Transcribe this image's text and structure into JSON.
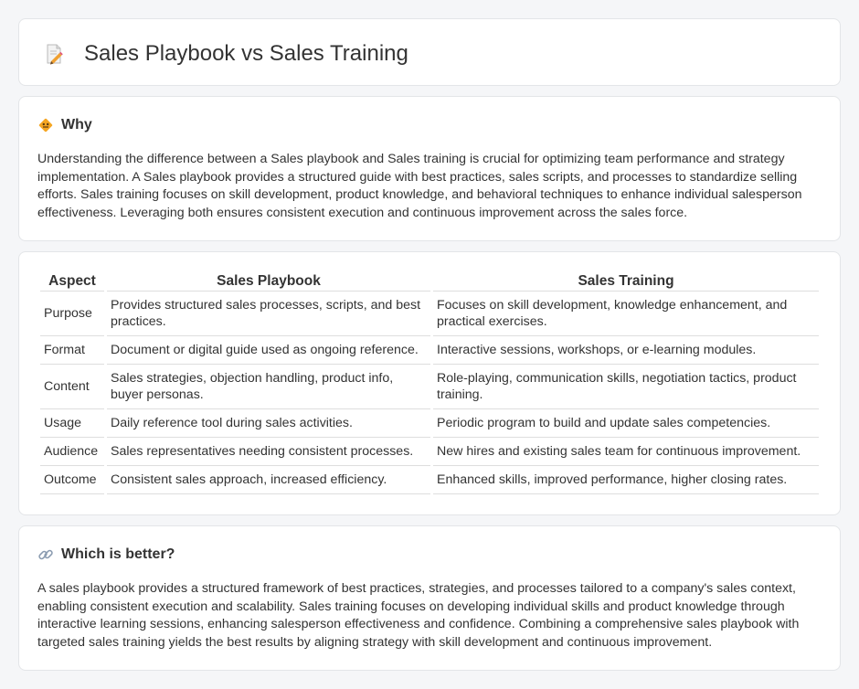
{
  "header": {
    "title": "Sales Playbook vs Sales Training",
    "icon": "document-pencil-icon"
  },
  "why": {
    "icon": "diamond-sign-icon",
    "title": "Why",
    "text": "Understanding the difference between a Sales playbook and Sales training is crucial for optimizing team performance and strategy implementation. A Sales playbook provides a structured guide with best practices, sales scripts, and processes to standardize selling efforts. Sales training focuses on skill development, product knowledge, and behavioral techniques to enhance individual salesperson effectiveness. Leveraging both ensures consistent execution and continuous improvement across the sales force."
  },
  "table": {
    "headers": [
      "Aspect",
      "Sales Playbook",
      "Sales Training"
    ],
    "rows": [
      [
        "Purpose",
        "Provides structured sales processes, scripts, and best practices.",
        "Focuses on skill development, knowledge enhancement, and practical exercises."
      ],
      [
        "Format",
        "Document or digital guide used as ongoing reference.",
        "Interactive sessions, workshops, or e-learning modules."
      ],
      [
        "Content",
        "Sales strategies, objection handling, product info, buyer personas.",
        "Role-playing, communication skills, negotiation tactics, product training."
      ],
      [
        "Usage",
        "Daily reference tool during sales activities.",
        "Periodic program to build and update sales competencies."
      ],
      [
        "Audience",
        "Sales representatives needing consistent processes.",
        "New hires and existing sales team for continuous improvement."
      ],
      [
        "Outcome",
        "Consistent sales approach, increased efficiency.",
        "Enhanced skills, improved performance, higher closing rates."
      ]
    ]
  },
  "better": {
    "icon": "link-icon",
    "title": "Which is better?",
    "text": "A sales playbook provides a structured framework of best practices, strategies, and processes tailored to a company's sales context, enabling consistent execution and scalability. Sales training focuses on developing individual skills and product knowledge through interactive learning sessions, enhancing salesperson effectiveness and confidence. Combining a comprehensive sales playbook with targeted sales training yields the best results by aligning strategy with skill development and continuous improvement."
  },
  "colors": {
    "page_bg": "#f5f6f8",
    "card_bg": "#ffffff",
    "text": "#333333",
    "icon_orange": "#f0a030",
    "icon_pink": "#e05a7a"
  }
}
